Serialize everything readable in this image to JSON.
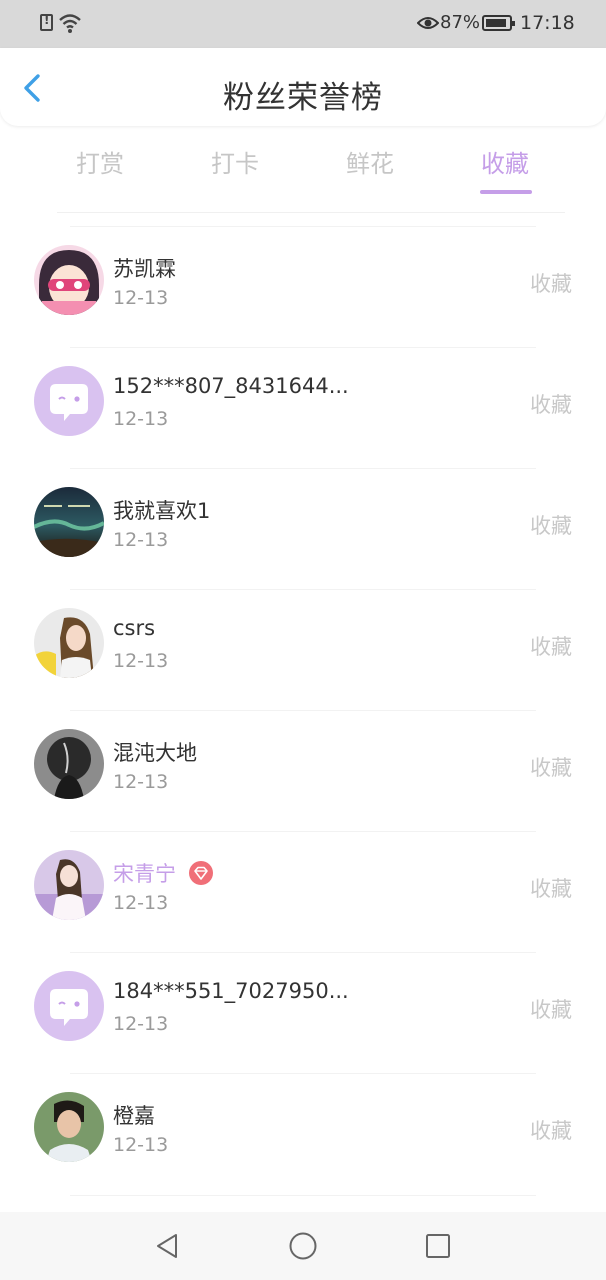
{
  "status_bar": {
    "battery_percent": "87%",
    "time": "17:18",
    "icons": [
      "sim-alert-icon",
      "wifi-icon",
      "eye-icon",
      "battery-icon"
    ]
  },
  "header": {
    "title": "粉丝荣誉榜",
    "back_icon": "chevron-left-icon"
  },
  "tabs": [
    {
      "label": "打赏",
      "active": false
    },
    {
      "label": "打卡",
      "active": false
    },
    {
      "label": "鲜花",
      "active": false
    },
    {
      "label": "收藏",
      "active": true
    }
  ],
  "colors": {
    "accent": "#c59ee8",
    "back_arrow": "#3fa0e6",
    "action_text": "#c8c8c8"
  },
  "list": {
    "items": [
      {
        "name": "苏凯霖",
        "date": "12-13",
        "action": "收藏",
        "vip": false
      },
      {
        "name": "152***807_8431644...",
        "date": "12-13",
        "action": "收藏",
        "vip": false
      },
      {
        "name": "我就喜欢1",
        "date": "12-13",
        "action": "收藏",
        "vip": false
      },
      {
        "name": "csrs",
        "date": "12-13",
        "action": "收藏",
        "vip": false
      },
      {
        "name": "混沌大地",
        "date": "12-13",
        "action": "收藏",
        "vip": false
      },
      {
        "name": "宋青宁",
        "date": "12-13",
        "action": "收藏",
        "vip": true
      },
      {
        "name": "184***551_7027950...",
        "date": "12-13",
        "action": "收藏",
        "vip": false
      },
      {
        "name": "橙嘉",
        "date": "12-13",
        "action": "收藏",
        "vip": false
      }
    ]
  },
  "nav_bar": {
    "icons": [
      "back-triangle-icon",
      "home-circle-icon",
      "recents-square-icon"
    ]
  }
}
